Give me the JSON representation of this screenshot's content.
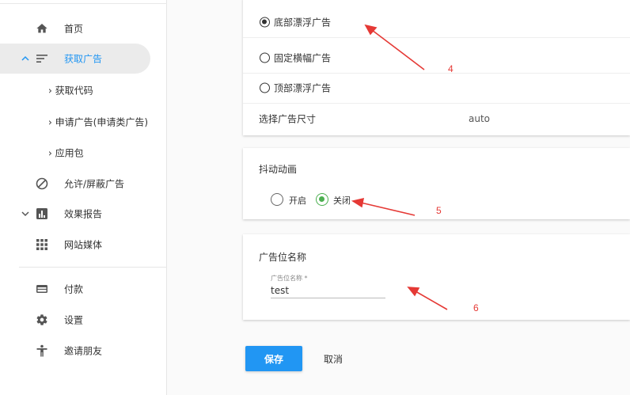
{
  "sidebar": {
    "items": [
      {
        "label": "首页",
        "icon": "home-icon"
      },
      {
        "label": "获取广告",
        "icon": "sort-list-icon",
        "active": true,
        "expanded": true
      },
      {
        "label": "获取代码"
      },
      {
        "label": "申请广告(申请类广告)"
      },
      {
        "label": "应用包"
      },
      {
        "label": "允许/屏蔽广告",
        "icon": "block-icon"
      },
      {
        "label": "效果报告",
        "icon": "bar-chart-icon"
      },
      {
        "label": "网站媒体",
        "icon": "grid-icon"
      },
      {
        "label": "付款",
        "icon": "credit-card-icon"
      },
      {
        "label": "设置",
        "icon": "gear-icon"
      },
      {
        "label": "邀请朋友",
        "icon": "person-icon"
      }
    ],
    "sub_prefix": "›"
  },
  "ad_type": {
    "options": [
      {
        "label": "底部漂浮广告",
        "selected": true
      },
      {
        "label": "固定横幅广告",
        "selected": false
      },
      {
        "label": "顶部漂浮广告",
        "selected": false
      }
    ]
  },
  "ad_size": {
    "label": "选择广告尺寸",
    "value": "auto"
  },
  "shake": {
    "title": "抖动动画",
    "on_label": "开启",
    "off_label": "关闭",
    "selected": "off"
  },
  "ad_name": {
    "title": "广告位名称",
    "field_label": "广告位名称 *",
    "value": "test"
  },
  "actions": {
    "save": "保存",
    "cancel": "取消"
  },
  "annotations": [
    "4",
    "5",
    "6"
  ],
  "colors": {
    "accent": "#2196f3",
    "radio_on": "#4caf50",
    "annotation": "#e53935"
  }
}
